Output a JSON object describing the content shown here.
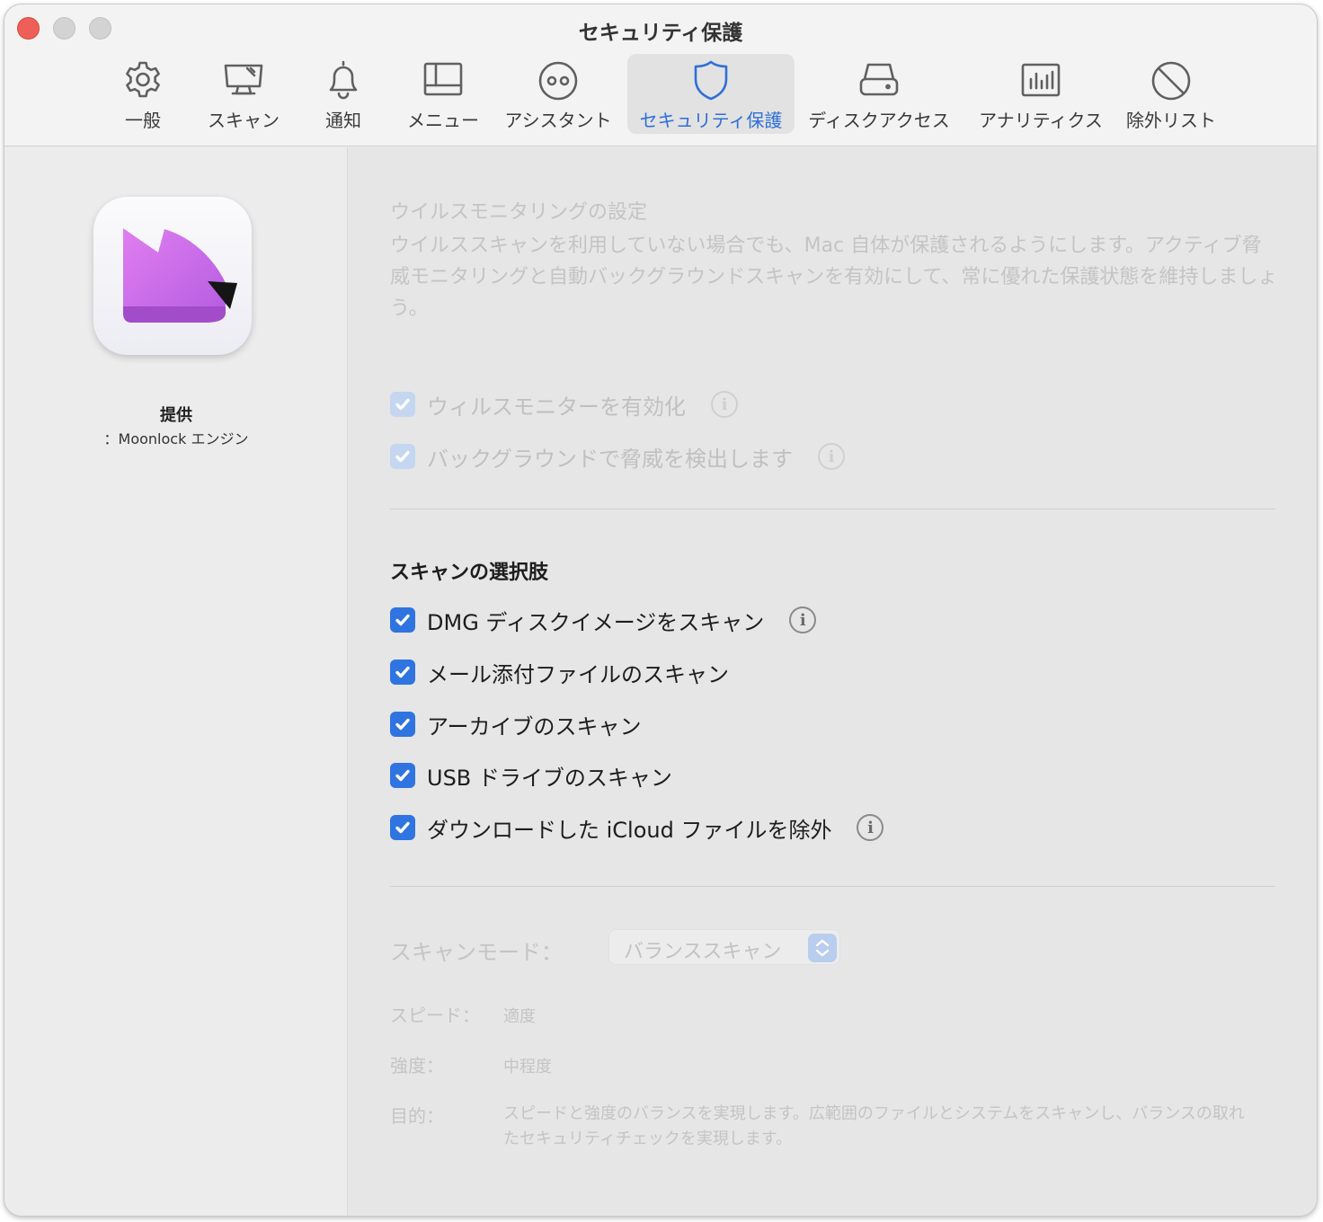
{
  "window": {
    "title": "セキュリティ保護"
  },
  "tabs": [
    {
      "label": "一般",
      "icon": "gear-icon"
    },
    {
      "label": "スキャン",
      "icon": "monitor-scan-icon"
    },
    {
      "label": "通知",
      "icon": "bell-icon"
    },
    {
      "label": "メニュー",
      "icon": "menu-window-icon"
    },
    {
      "label": "アシスタント",
      "icon": "assistant-eyes-icon"
    },
    {
      "label": "セキュリティ保護",
      "icon": "shield-icon",
      "active": true
    },
    {
      "label": "ディスクアクセス",
      "icon": "disk-drive-icon"
    },
    {
      "label": "アナリティクス",
      "icon": "bar-chart-icon"
    },
    {
      "label": "除外リスト",
      "icon": "prohibited-icon"
    }
  ],
  "sidebar": {
    "app_icon": "moonlock-logo",
    "provided_by": "提供",
    "engine": "：Moonlock エンジン"
  },
  "virus_monitoring": {
    "title": "ウイルスモニタリングの設定",
    "description": "ウイルススキャンを利用していない場合でも、Mac 自体が保護されるようにします。アクティブ脅威モニタリングと自動バックグラウンドスキャンを有効にして、常に優れた保護状態を維持しましょう。",
    "options": [
      {
        "label": "ウィルスモニターを有効化",
        "checked": true,
        "enabled": false,
        "info": true
      },
      {
        "label": "バックグラウンドで脅威を検出します",
        "checked": true,
        "enabled": false,
        "info": true
      }
    ]
  },
  "scan_options": {
    "title": "スキャンの選択肢",
    "options": [
      {
        "label": "DMG ディスクイメージをスキャン",
        "checked": true,
        "info": true
      },
      {
        "label": "メール添付ファイルのスキャン",
        "checked": true,
        "info": false
      },
      {
        "label": "アーカイブのスキャン",
        "checked": true,
        "info": false
      },
      {
        "label": "USB ドライブのスキャン",
        "checked": true,
        "info": false
      },
      {
        "label": "ダウンロードした iCloud ファイルを除外",
        "checked": true,
        "info": true
      }
    ]
  },
  "scan_mode": {
    "label": "スキャンモード：",
    "selected": "バランススキャン",
    "speed_label": "スピード：",
    "speed_value": "適度",
    "strength_label": "強度：",
    "strength_value": "中程度",
    "purpose_label": "目的：",
    "purpose_value": "スピードと強度のバランスを実現します。広範囲のファイルとシステムをスキャンし、バランスの取れたセキュリティチェックを実現します。"
  },
  "colors": {
    "accent": "#2f6fd8",
    "checkbox": "#2f74e0",
    "close_button": "#ee5f57"
  }
}
